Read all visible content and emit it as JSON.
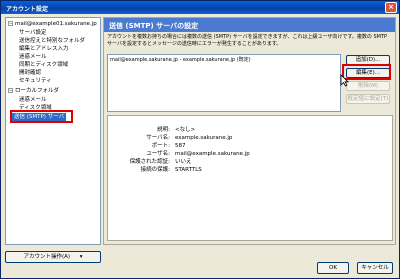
{
  "window": {
    "title": "アカウント設定",
    "close_label": "×"
  },
  "tree": {
    "account": "mail@example01.sakurane.jp",
    "account_expander": "−",
    "account_children": [
      "サーバ設定",
      "送信控えと特別なフォルダ",
      "編集とアドレス入力",
      "迷惑メール",
      "同期とディスク領域",
      "開封確認",
      "セキュリティ"
    ],
    "local": "ローカルフォルダ",
    "local_expander": "−",
    "local_children": [
      "迷惑メール",
      "ディスク領域"
    ],
    "smtp": "送信 (SMTP) サーバ"
  },
  "account_actions_label": "アカウント操作(A)",
  "account_actions_arrow": "▾",
  "panel": {
    "title": "送信 (SMTP) サーバの設定",
    "description": "アカウントを複数お持ちの場合には複数の送信 (SMTP) サーバを設定できますが、これは上級ユーザ向けです。複数の SMTP サーバを設定するとメッセージの送信時にエラーが発生することがあります。",
    "server_entry": "mail@example.sakurane.jp - example.sakurane.jp (既定)",
    "buttons": {
      "add": "追加(D)...",
      "edit": "編集(E)...",
      "delete": "削除(M)",
      "set_default": "既定値に設定(T)"
    },
    "details": {
      "desc_label": "説明:",
      "desc_value": "<なし>",
      "server_label": "サーバ名:",
      "server_value": "example.sakurane.jp",
      "port_label": "ポート:",
      "port_value": "587",
      "user_label": "ユーザ名:",
      "user_value": "mail@example.sakurane.jp",
      "auth_label": "保護された認証:",
      "auth_value": "いいえ",
      "conn_label": "接続の保護:",
      "conn_value": "STARTTLS"
    }
  },
  "footer": {
    "ok": "OK",
    "cancel": "キャンセル"
  },
  "colors": {
    "highlight": "#e00000",
    "title_bar": "#0a5fd8",
    "header": "#4a7bd0",
    "selection": "#316ac5"
  }
}
